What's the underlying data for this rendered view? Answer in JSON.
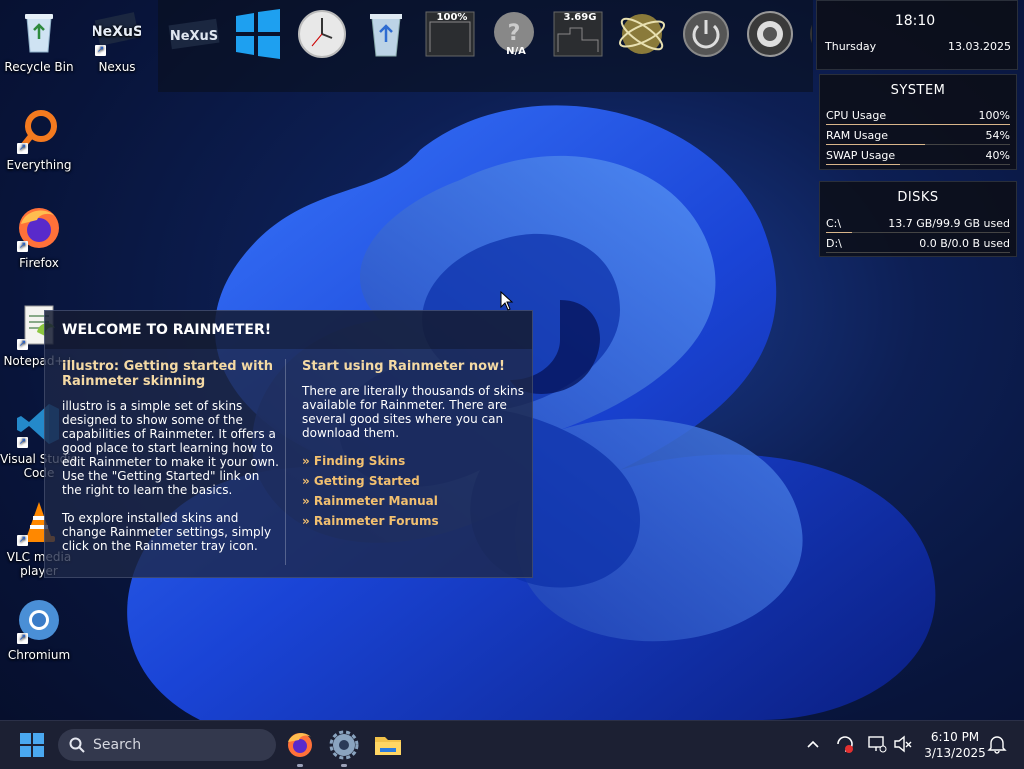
{
  "desktop_icons": [
    {
      "label": "Recycle Bin"
    },
    {
      "label": "Nexus"
    },
    {
      "label": "Everything"
    },
    {
      "label": "Firefox"
    },
    {
      "label": "Notepad++"
    },
    {
      "label": "Visual Studio Code"
    },
    {
      "label": "VLC media player"
    },
    {
      "label": "Chromium"
    }
  ],
  "dock": {
    "items": [
      {
        "name": "nexus-logo-icon"
      },
      {
        "name": "windows-logo-icon"
      },
      {
        "name": "clock-icon"
      },
      {
        "name": "recycle-bin-icon"
      },
      {
        "name": "cpu-meter-icon",
        "label": "100%"
      },
      {
        "name": "help-icon",
        "label": "N/A"
      },
      {
        "name": "ram-meter-icon",
        "label": "3.69G"
      },
      {
        "name": "network-globe-icon"
      },
      {
        "name": "power-icon"
      },
      {
        "name": "speaker-icon"
      },
      {
        "name": "webcam-icon"
      }
    ]
  },
  "clock_widget": {
    "time": "18:10",
    "day": "Thursday",
    "date": "13.03.2025"
  },
  "system_widget": {
    "title": "SYSTEM",
    "rows": [
      {
        "label": "CPU Usage",
        "value": "100%",
        "level": 1.0
      },
      {
        "label": "RAM Usage",
        "value": "54%",
        "level": 0.54
      },
      {
        "label": "SWAP Usage",
        "value": "40%",
        "level": 0.4
      }
    ]
  },
  "disks_widget": {
    "title": "DISKS",
    "rows": [
      {
        "label": "C:\\",
        "value": "13.7 GB/99.9 GB used",
        "level": 0.14
      },
      {
        "label": "D:\\",
        "value": "0.0 B/0.0 B used",
        "level": 0.0
      }
    ]
  },
  "welcome": {
    "title": "WELCOME TO RAINMETER!",
    "left": {
      "heading": "illustro: Getting started with Rainmeter skinning",
      "para1": "illustro is a simple set of skins designed to show some of the capabilities of Rainmeter. It offers a good place to start learning how to edit Rainmeter to make it your own. Use the \"Getting Started\" link on the right to learn the basics.",
      "para2": "To explore installed skins and change Rainmeter settings, simply click on the Rainmeter tray icon."
    },
    "right": {
      "heading": "Start using Rainmeter now!",
      "para": "There are literally thousands of skins available for Rainmeter. There are several good sites where you can download them.",
      "links": [
        "» Finding Skins",
        "» Getting Started",
        "» Rainmeter Manual",
        "» Rainmeter Forums"
      ]
    }
  },
  "taskbar": {
    "search_placeholder": "Search",
    "apps": [
      "firefox-icon",
      "settings-gear-icon",
      "file-explorer-icon"
    ],
    "time": "6:10 PM",
    "date": "3/13/2025"
  },
  "colors": {
    "accent_link": "#f2c070",
    "meter_fill": "#d8b58a",
    "taskbar": "#1c2033"
  }
}
